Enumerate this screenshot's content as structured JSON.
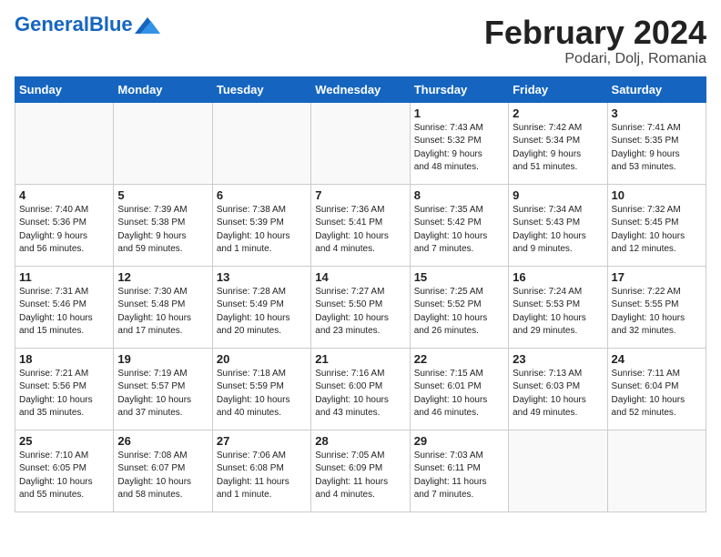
{
  "header": {
    "logo_line1": "General",
    "logo_line2": "Blue",
    "month": "February 2024",
    "location": "Podari, Dolj, Romania"
  },
  "weekdays": [
    "Sunday",
    "Monday",
    "Tuesday",
    "Wednesday",
    "Thursday",
    "Friday",
    "Saturday"
  ],
  "weeks": [
    [
      {
        "day": "",
        "detail": ""
      },
      {
        "day": "",
        "detail": ""
      },
      {
        "day": "",
        "detail": ""
      },
      {
        "day": "",
        "detail": ""
      },
      {
        "day": "1",
        "detail": "Sunrise: 7:43 AM\nSunset: 5:32 PM\nDaylight: 9 hours\nand 48 minutes."
      },
      {
        "day": "2",
        "detail": "Sunrise: 7:42 AM\nSunset: 5:34 PM\nDaylight: 9 hours\nand 51 minutes."
      },
      {
        "day": "3",
        "detail": "Sunrise: 7:41 AM\nSunset: 5:35 PM\nDaylight: 9 hours\nand 53 minutes."
      }
    ],
    [
      {
        "day": "4",
        "detail": "Sunrise: 7:40 AM\nSunset: 5:36 PM\nDaylight: 9 hours\nand 56 minutes."
      },
      {
        "day": "5",
        "detail": "Sunrise: 7:39 AM\nSunset: 5:38 PM\nDaylight: 9 hours\nand 59 minutes."
      },
      {
        "day": "6",
        "detail": "Sunrise: 7:38 AM\nSunset: 5:39 PM\nDaylight: 10 hours\nand 1 minute."
      },
      {
        "day": "7",
        "detail": "Sunrise: 7:36 AM\nSunset: 5:41 PM\nDaylight: 10 hours\nand 4 minutes."
      },
      {
        "day": "8",
        "detail": "Sunrise: 7:35 AM\nSunset: 5:42 PM\nDaylight: 10 hours\nand 7 minutes."
      },
      {
        "day": "9",
        "detail": "Sunrise: 7:34 AM\nSunset: 5:43 PM\nDaylight: 10 hours\nand 9 minutes."
      },
      {
        "day": "10",
        "detail": "Sunrise: 7:32 AM\nSunset: 5:45 PM\nDaylight: 10 hours\nand 12 minutes."
      }
    ],
    [
      {
        "day": "11",
        "detail": "Sunrise: 7:31 AM\nSunset: 5:46 PM\nDaylight: 10 hours\nand 15 minutes."
      },
      {
        "day": "12",
        "detail": "Sunrise: 7:30 AM\nSunset: 5:48 PM\nDaylight: 10 hours\nand 17 minutes."
      },
      {
        "day": "13",
        "detail": "Sunrise: 7:28 AM\nSunset: 5:49 PM\nDaylight: 10 hours\nand 20 minutes."
      },
      {
        "day": "14",
        "detail": "Sunrise: 7:27 AM\nSunset: 5:50 PM\nDaylight: 10 hours\nand 23 minutes."
      },
      {
        "day": "15",
        "detail": "Sunrise: 7:25 AM\nSunset: 5:52 PM\nDaylight: 10 hours\nand 26 minutes."
      },
      {
        "day": "16",
        "detail": "Sunrise: 7:24 AM\nSunset: 5:53 PM\nDaylight: 10 hours\nand 29 minutes."
      },
      {
        "day": "17",
        "detail": "Sunrise: 7:22 AM\nSunset: 5:55 PM\nDaylight: 10 hours\nand 32 minutes."
      }
    ],
    [
      {
        "day": "18",
        "detail": "Sunrise: 7:21 AM\nSunset: 5:56 PM\nDaylight: 10 hours\nand 35 minutes."
      },
      {
        "day": "19",
        "detail": "Sunrise: 7:19 AM\nSunset: 5:57 PM\nDaylight: 10 hours\nand 37 minutes."
      },
      {
        "day": "20",
        "detail": "Sunrise: 7:18 AM\nSunset: 5:59 PM\nDaylight: 10 hours\nand 40 minutes."
      },
      {
        "day": "21",
        "detail": "Sunrise: 7:16 AM\nSunset: 6:00 PM\nDaylight: 10 hours\nand 43 minutes."
      },
      {
        "day": "22",
        "detail": "Sunrise: 7:15 AM\nSunset: 6:01 PM\nDaylight: 10 hours\nand 46 minutes."
      },
      {
        "day": "23",
        "detail": "Sunrise: 7:13 AM\nSunset: 6:03 PM\nDaylight: 10 hours\nand 49 minutes."
      },
      {
        "day": "24",
        "detail": "Sunrise: 7:11 AM\nSunset: 6:04 PM\nDaylight: 10 hours\nand 52 minutes."
      }
    ],
    [
      {
        "day": "25",
        "detail": "Sunrise: 7:10 AM\nSunset: 6:05 PM\nDaylight: 10 hours\nand 55 minutes."
      },
      {
        "day": "26",
        "detail": "Sunrise: 7:08 AM\nSunset: 6:07 PM\nDaylight: 10 hours\nand 58 minutes."
      },
      {
        "day": "27",
        "detail": "Sunrise: 7:06 AM\nSunset: 6:08 PM\nDaylight: 11 hours\nand 1 minute."
      },
      {
        "day": "28",
        "detail": "Sunrise: 7:05 AM\nSunset: 6:09 PM\nDaylight: 11 hours\nand 4 minutes."
      },
      {
        "day": "29",
        "detail": "Sunrise: 7:03 AM\nSunset: 6:11 PM\nDaylight: 11 hours\nand 7 minutes."
      },
      {
        "day": "",
        "detail": ""
      },
      {
        "day": "",
        "detail": ""
      }
    ]
  ]
}
